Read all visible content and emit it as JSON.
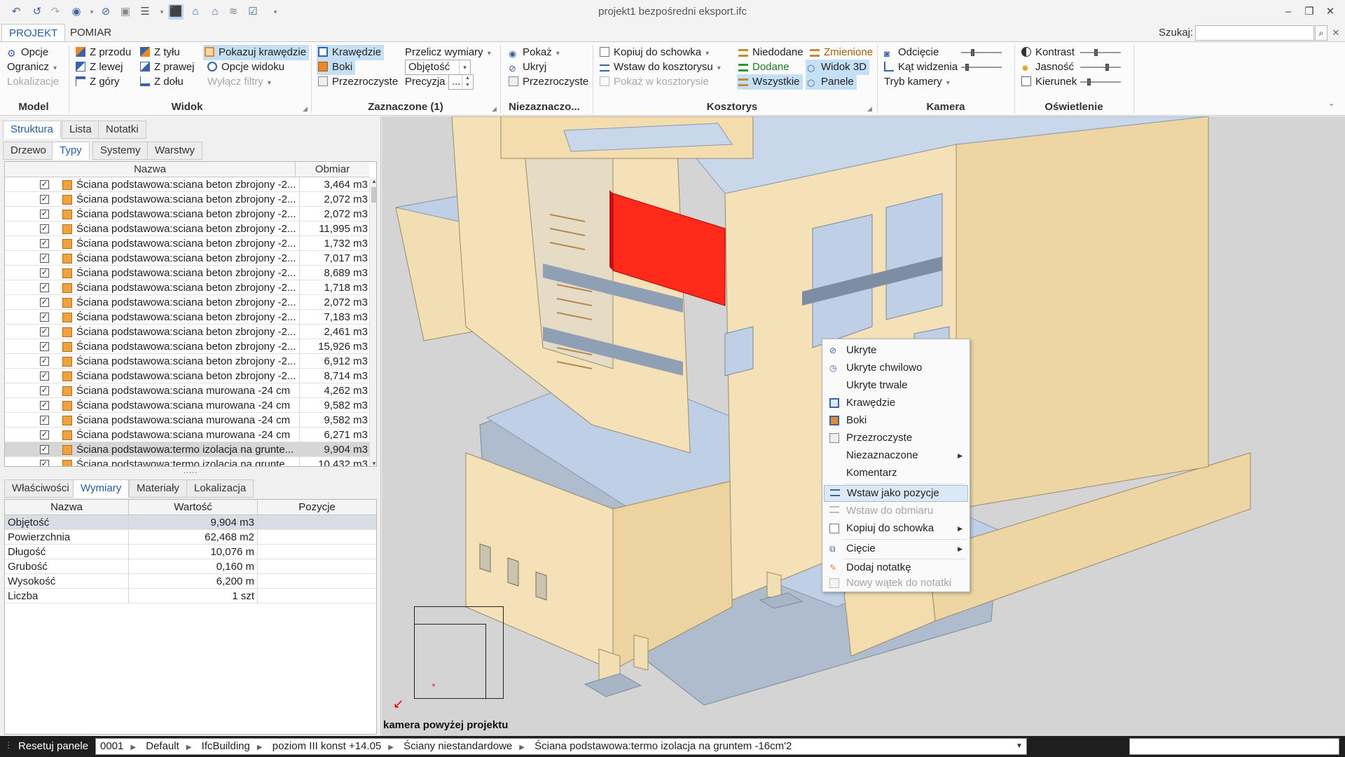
{
  "window": {
    "title": "projekt1 bezpośredni  eksport.ifc",
    "minimize": "–",
    "restore": "❐",
    "close": "✕"
  },
  "ribbon_tabs": [
    "PROJEKT",
    "POMIAR"
  ],
  "search": {
    "label": "Szukaj:",
    "value": "",
    "placeholder": ""
  },
  "ribbon": {
    "model": {
      "label": "Model",
      "items": [
        "Opcje",
        "Ogranicz",
        "Lokalizacje"
      ]
    },
    "widok": {
      "label": "Widok",
      "items": [
        "Z przodu",
        "Z tyłu",
        "Z lewej",
        "Z prawej",
        "Z góry",
        "Z dołu",
        "Pokazuj krawędzie",
        "Opcje widoku",
        "Wyłącz filtry"
      ]
    },
    "zaznaczone": {
      "label": "Zaznaczone (1)",
      "items": [
        "Krawędzie",
        "Boki",
        "Przezroczyste",
        "Przelicz wymiary",
        "Precyzja"
      ],
      "measure_value": "Objętość",
      "precision_value": "..."
    },
    "niezaznaczone": {
      "label": "Niezaznaczo...",
      "items": [
        "Pokaż",
        "Ukryj",
        "Przezroczyste"
      ]
    },
    "kosztorys": {
      "label": "Kosztorys",
      "items": [
        "Kopiuj do schowka",
        "Wstaw do kosztorysu",
        "Pokaż w kosztorysie",
        "Niedodane",
        "Dodane",
        "Wszystkie",
        "Zmienione",
        "Widok 3D",
        "Panele"
      ]
    },
    "kamera": {
      "label": "Kamera",
      "items": [
        "Odcięcie",
        "Kąt widzenia",
        "Tryb kamery"
      ]
    },
    "oswietlenie": {
      "label": "Oświetlenie",
      "items": [
        "Kontrast",
        "Jasność",
        "Kierunek"
      ]
    }
  },
  "left_panel": {
    "top_tabs": [
      "Struktura",
      "Lista",
      "Notatki"
    ],
    "sub_tabs": [
      "Drzewo",
      "Typy",
      "Systemy",
      "Warstwy"
    ],
    "type_columns": [
      "Nazwa",
      "Obmiar"
    ],
    "type_rows": [
      {
        "name": "Ściana podstawowa:sciana beton zbrojony -2...",
        "value": "3,464 m3"
      },
      {
        "name": "Ściana podstawowa:sciana beton zbrojony -2...",
        "value": "2,072 m3"
      },
      {
        "name": "Ściana podstawowa:sciana beton zbrojony -2...",
        "value": "2,072 m3"
      },
      {
        "name": "Ściana podstawowa:sciana beton zbrojony -2...",
        "value": "11,995 m3"
      },
      {
        "name": "Ściana podstawowa:sciana beton zbrojony -2...",
        "value": "1,732 m3"
      },
      {
        "name": "Ściana podstawowa:sciana beton zbrojony -2...",
        "value": "7,017 m3"
      },
      {
        "name": "Ściana podstawowa:sciana beton zbrojony -2...",
        "value": "8,689 m3"
      },
      {
        "name": "Ściana podstawowa:sciana beton zbrojony -2...",
        "value": "1,718 m3"
      },
      {
        "name": "Ściana podstawowa:sciana beton zbrojony -2...",
        "value": "2,072 m3"
      },
      {
        "name": "Ściana podstawowa:sciana beton zbrojony -2...",
        "value": "7,183 m3"
      },
      {
        "name": "Ściana podstawowa:sciana beton zbrojony -2...",
        "value": "2,461 m3"
      },
      {
        "name": "Ściana podstawowa:sciana beton zbrojony -2...",
        "value": "15,926 m3"
      },
      {
        "name": "Ściana podstawowa:sciana beton zbrojony -2...",
        "value": "6,912 m3"
      },
      {
        "name": "Ściana podstawowa:sciana beton zbrojony -2...",
        "value": "8,714 m3"
      },
      {
        "name": "Ściana podstawowa:sciana murowana  -24 cm",
        "value": "4,262 m3"
      },
      {
        "name": "Ściana podstawowa:sciana murowana  -24 cm",
        "value": "9,582 m3"
      },
      {
        "name": "Ściana podstawowa:sciana murowana  -24 cm",
        "value": "9,582 m3"
      },
      {
        "name": "Ściana podstawowa:sciana murowana  -24 cm",
        "value": "6,271 m3"
      },
      {
        "name": "Ściana podstawowa:termo izolacja na grunte...",
        "value": "9,904 m3"
      },
      {
        "name": "Ściana podstawowa:termo izolacja na grunte...",
        "value": "10,432 m3"
      }
    ],
    "splitter": ".....",
    "bottom_tabs": [
      "Właściwości",
      "Wymiary",
      "Materiały",
      "Lokalizacja"
    ],
    "prop_columns": [
      "Nazwa",
      "Wartość",
      "Pozycje"
    ],
    "prop_rows": [
      {
        "name": "Objętość",
        "value": "9,904 m3"
      },
      {
        "name": "Powierzchnia",
        "value": "62,468 m2"
      },
      {
        "name": "Długość",
        "value": "10,076 m"
      },
      {
        "name": "Grubość",
        "value": "0,160 m"
      },
      {
        "name": "Wysokość",
        "value": "6,200 m"
      },
      {
        "name": "Liczba",
        "value": "1 szt"
      }
    ]
  },
  "viewport": {
    "camera_label": "kamera powyżej projektu",
    "selected_color": "#ff2a1a"
  },
  "context_menu": {
    "items": [
      {
        "label": "Ukryte",
        "icon": "hide-icon"
      },
      {
        "label": "Ukryte chwilowo",
        "icon": "hide-temp-icon"
      },
      {
        "label": "Ukryte trwale",
        "icon": ""
      },
      {
        "label": "Krawędzie",
        "icon": "edges-icon"
      },
      {
        "label": "Boki",
        "icon": "faces-icon"
      },
      {
        "label": "Przezroczyste",
        "icon": "transparent-icon"
      },
      {
        "label": "Niezaznaczone",
        "icon": ""
      },
      {
        "label": "Komentarz",
        "icon": ""
      },
      {
        "label": "Wstaw jako pozycje",
        "icon": "insert-positions-icon"
      },
      {
        "label": "Wstaw do obmiaru",
        "icon": "insert-measure-icon"
      },
      {
        "label": "Kopiuj do schowka",
        "icon": "copy-icon"
      },
      {
        "label": "Cięcie",
        "icon": "cut-icon"
      },
      {
        "label": "Dodaj notatkę",
        "icon": "add-note-icon"
      },
      {
        "label": "Nowy wątek do notatki",
        "icon": "new-thread-icon"
      }
    ]
  },
  "status": {
    "reset_label": "Resetuj panele",
    "breadcrumb": [
      "0001",
      "Default",
      "IfcBuilding",
      "poziom III konst +14.05",
      "Ściany niestandardowe",
      "Ściana podstawowa:termo izolacja na gruntem -16cm'2"
    ]
  }
}
